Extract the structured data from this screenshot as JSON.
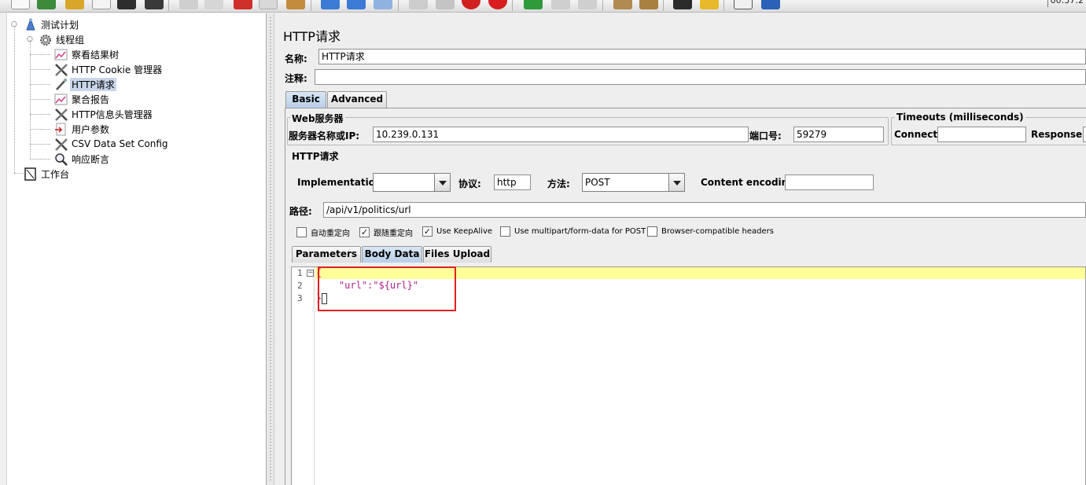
{
  "toolbar": {
    "clock": "00:37:2",
    "buttons": [
      "new-icon",
      "templates-icon",
      "open-icon",
      "close-icon",
      "save-icon",
      "save-as-icon",
      "cut-icon",
      "copy-icon",
      "paste-icon",
      "expand-icon",
      "collapse-icon",
      "toggle-icon",
      "start-icon",
      "start-no-pause-icon",
      "stop-icon",
      "shutdown-icon",
      "remote-start-icon",
      "remote-stop-icon",
      "remote-exit-icon",
      "clear-icon",
      "clear-all-icon",
      "search-icon",
      "reset-search-icon",
      "function-helper-icon",
      "help-icon"
    ]
  },
  "tree": {
    "items": [
      {
        "label": "测试计划",
        "icon": "test-plan-icon"
      },
      {
        "label": "线程组",
        "icon": "thread-group-icon"
      },
      {
        "label": "察看结果树",
        "icon": "view-results-tree-icon"
      },
      {
        "label": "HTTP Cookie 管理器",
        "icon": "cookie-manager-icon"
      },
      {
        "label": "HTTP请求",
        "icon": "http-request-icon"
      },
      {
        "label": "聚合报告",
        "icon": "aggregate-report-icon"
      },
      {
        "label": "HTTP信息头管理器",
        "icon": "header-manager-icon"
      },
      {
        "label": "用户参数",
        "icon": "user-parameters-icon"
      },
      {
        "label": "CSV Data Set Config",
        "icon": "csv-data-set-icon"
      },
      {
        "label": "响应断言",
        "icon": "response-assertion-icon"
      },
      {
        "label": "工作台",
        "icon": "workbench-icon"
      }
    ],
    "selected": "HTTP请求"
  },
  "panel": {
    "title": "HTTP请求",
    "name_label": "名称:",
    "name_value": "HTTP请求",
    "comment_label": "注释:",
    "comment_value": "",
    "tabs": [
      "Basic",
      "Advanced"
    ],
    "web_server": {
      "title": "Web服务器",
      "server_label": "服务器名称或IP:",
      "server_value": "10.239.0.131",
      "port_label": "端口号:",
      "port_value": "59279"
    },
    "timeouts": {
      "title": "Timeouts (milliseconds)",
      "connect_label": "Connect:",
      "connect_value": "",
      "response_label": "Response:",
      "response_value": ""
    },
    "http_request": {
      "title": "HTTP请求",
      "implementation_label": "Implementation:",
      "implementation_value": "",
      "protocol_label": "协议:",
      "protocol_value": "http",
      "method_label": "方法:",
      "method_value": "POST",
      "encoding_label": "Content encoding:",
      "encoding_value": "",
      "path_label": "路径:",
      "path_value": "/api/v1/politics/url"
    },
    "checkboxes": [
      {
        "label": "自动重定向",
        "checked": false
      },
      {
        "label": "跟随重定向",
        "checked": true
      },
      {
        "label": "Use KeepAlive",
        "checked": true
      },
      {
        "label": "Use multipart/form-data for POST",
        "checked": false
      },
      {
        "label": "Browser-compatible headers",
        "checked": false
      }
    ],
    "sub_tabs": [
      "Parameters",
      "Body Data",
      "Files Upload"
    ],
    "active_sub_tab": "Body Data",
    "editor": {
      "line_numbers": [
        "1",
        "2",
        "3"
      ],
      "lines": [
        "{",
        "    \"url\":\"${url}\"",
        "}"
      ]
    }
  }
}
